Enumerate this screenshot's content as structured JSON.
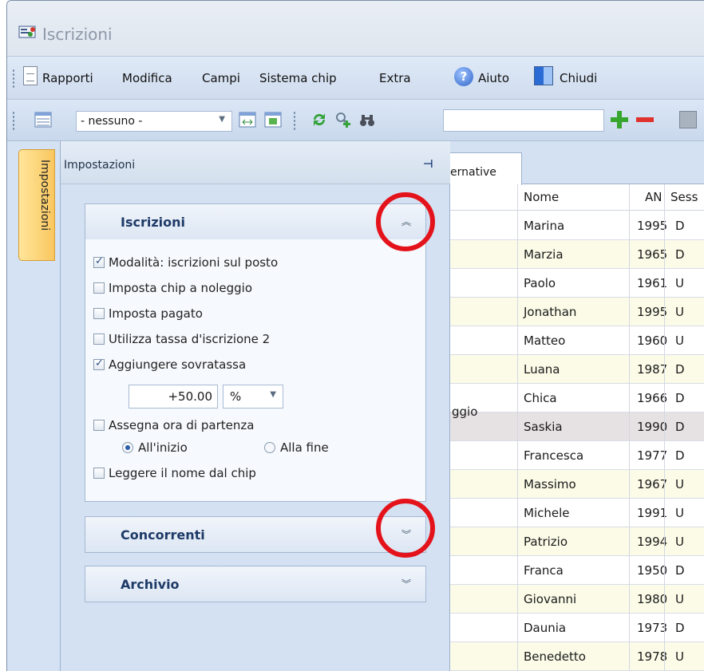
{
  "window": {
    "title": "Iscrizioni"
  },
  "menu": {
    "items": [
      "Rapporti",
      "Modifica",
      "Campi",
      "Sistema chip",
      "Extra",
      "Aiuto",
      "Chiudi"
    ]
  },
  "toolbar": {
    "view_select": "- nessuno -",
    "search_value": ""
  },
  "sidebar": {
    "tab_label": "Impostazioni"
  },
  "panel": {
    "title": "Impostazioni",
    "groups": [
      {
        "title": "Iscrizioni",
        "state": "expanded"
      },
      {
        "title": "Concorrenti",
        "state": "collapsed"
      },
      {
        "title": "Archivio",
        "state": "collapsed"
      }
    ],
    "options": {
      "modalita": {
        "label": "Modalità: iscrizioni sul posto",
        "checked": true
      },
      "chip_noleggio": {
        "label": "Imposta chip a noleggio",
        "checked": false
      },
      "pagato": {
        "label": "Imposta pagato",
        "checked": false
      },
      "tassa2": {
        "label": "Utilizza tassa d'iscrizione 2",
        "checked": false
      },
      "sovratassa": {
        "label": "Aggiungere sovratassa",
        "checked": true
      },
      "ora_partenza": {
        "label": "Assegna ora di partenza",
        "checked": false
      },
      "leggere_nome": {
        "label": "Leggere il nome dal chip",
        "checked": false
      }
    },
    "surcharge_value": "+50.00",
    "surcharge_unit": "%",
    "radio_start": "All'inizio",
    "radio_end": "Alla fine"
  },
  "grid": {
    "tab_label": "ernative",
    "columns": {
      "nome": "Nome",
      "an": "AN",
      "sesso": "Sess"
    },
    "partial_cell": "ggio",
    "rows": [
      {
        "nome": "Marina",
        "an": "1995",
        "sesso": "D"
      },
      {
        "nome": "Marzia",
        "an": "1965",
        "sesso": "D"
      },
      {
        "nome": "Paolo",
        "an": "1961",
        "sesso": "U"
      },
      {
        "nome": "Jonathan",
        "an": "1995",
        "sesso": "U"
      },
      {
        "nome": "Matteo",
        "an": "1960",
        "sesso": "U"
      },
      {
        "nome": "Luana",
        "an": "1987",
        "sesso": "D"
      },
      {
        "nome": "Chica",
        "an": "1966",
        "sesso": "D"
      },
      {
        "nome": "Saskia",
        "an": "1990",
        "sesso": "D"
      },
      {
        "nome": "Francesca",
        "an": "1977",
        "sesso": "D"
      },
      {
        "nome": "Massimo",
        "an": "1967",
        "sesso": "U"
      },
      {
        "nome": "Michele",
        "an": "1991",
        "sesso": "U"
      },
      {
        "nome": "Patrizio",
        "an": "1994",
        "sesso": "U"
      },
      {
        "nome": "Franca",
        "an": "1950",
        "sesso": "D"
      },
      {
        "nome": "Giovanni",
        "an": "1980",
        "sesso": "U"
      },
      {
        "nome": "Daunia",
        "an": "1973",
        "sesso": "D"
      },
      {
        "nome": "Benedetto",
        "an": "1978",
        "sesso": "U"
      }
    ]
  },
  "colors": {
    "accent": "#1e3a67",
    "highlight_circle": "#e4131b",
    "side_tab": "#f9c760"
  }
}
